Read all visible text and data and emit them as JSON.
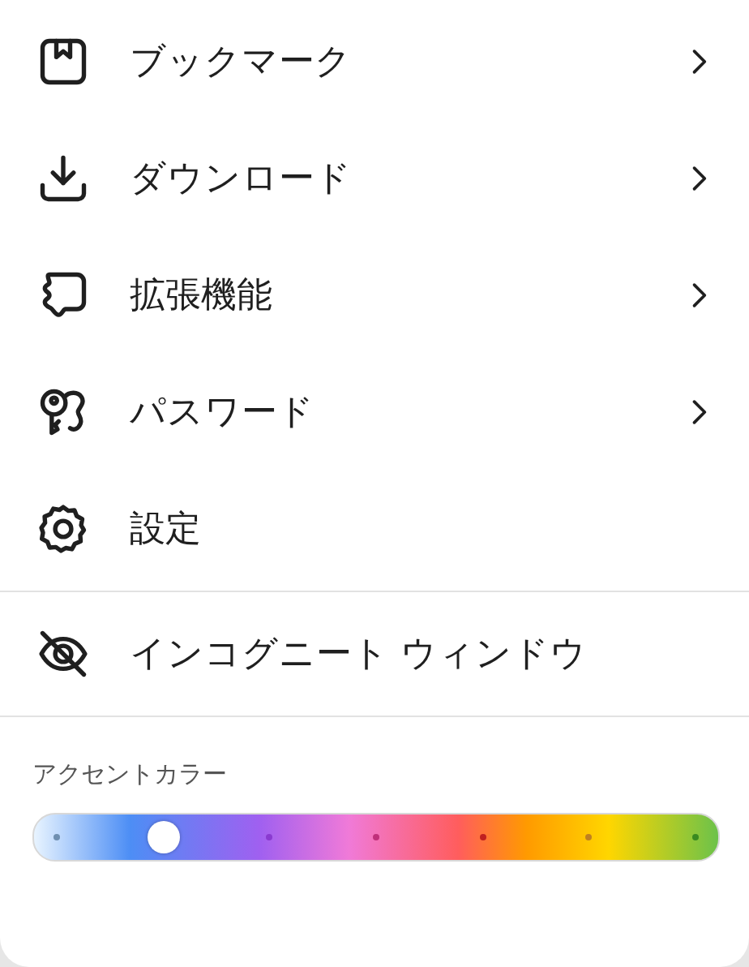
{
  "menu_items": [
    {
      "label": "ブックマーク",
      "submenu": true
    },
    {
      "label": "ダウンロード",
      "submenu": true
    },
    {
      "label": "拡張機能",
      "submenu": true
    },
    {
      "label": "パスワード",
      "submenu": true
    },
    {
      "label": "設定",
      "submenu": false
    }
  ],
  "incognito_item": {
    "label": "インコグニート ウィンドウ"
  },
  "accent_color": {
    "label": "アクセントカラー",
    "level": 0.19
  }
}
